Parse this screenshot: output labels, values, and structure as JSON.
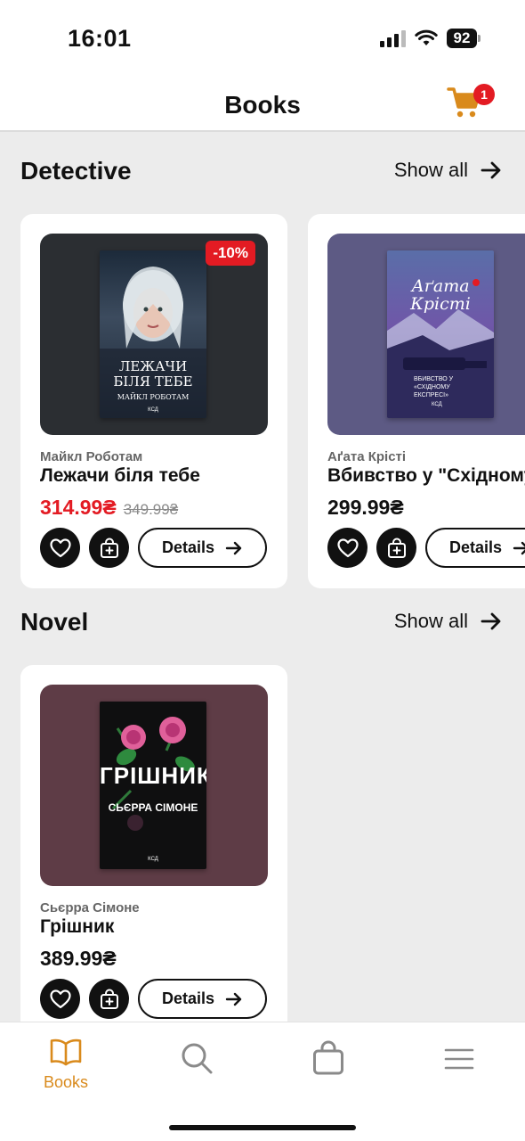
{
  "status_bar": {
    "time": "16:01",
    "battery": "92"
  },
  "header": {
    "title": "Books",
    "cart_count": "1"
  },
  "colors": {
    "accent": "#d98a1c",
    "sale": "#e31b23"
  },
  "sections": [
    {
      "title": "Detective",
      "show_all": "Show all",
      "books": [
        {
          "author": "Майкл Роботам",
          "title": "Лежачи біля тебе",
          "price": "314.99₴",
          "old_price": "349.99₴",
          "discount": "-10%",
          "cover_title": "ЛЕЖАЧИ БІЛЯ ТЕБЕ",
          "cover_author": "МАЙКЛ РОБОТАМ",
          "publisher": "КСД",
          "details": "Details"
        },
        {
          "author": "Аґата Крісті",
          "title": "Вбивство у \"Східному",
          "price": "299.99₴",
          "cover_title": "Аґата Крісті",
          "cover_subtitle": "ВБИВСТВО У «СХІДНОМУ ЕКСПРЕСІ»",
          "publisher": "КСД",
          "details": "Details"
        }
      ]
    },
    {
      "title": "Novel",
      "show_all": "Show all",
      "books": [
        {
          "author": "Сьєрра Сімоне",
          "title": "Грішник",
          "price": "389.99₴",
          "cover_title": "ГРІШНИК",
          "cover_author": "СЬЄРРА СІМОНЕ",
          "publisher": "КСД",
          "details": "Details"
        }
      ]
    }
  ],
  "bottom_nav": [
    {
      "label": "Books",
      "icon": "book-icon",
      "active": true
    },
    {
      "label": "",
      "icon": "search-icon"
    },
    {
      "label": "",
      "icon": "bag-icon"
    },
    {
      "label": "",
      "icon": "menu-icon"
    }
  ]
}
